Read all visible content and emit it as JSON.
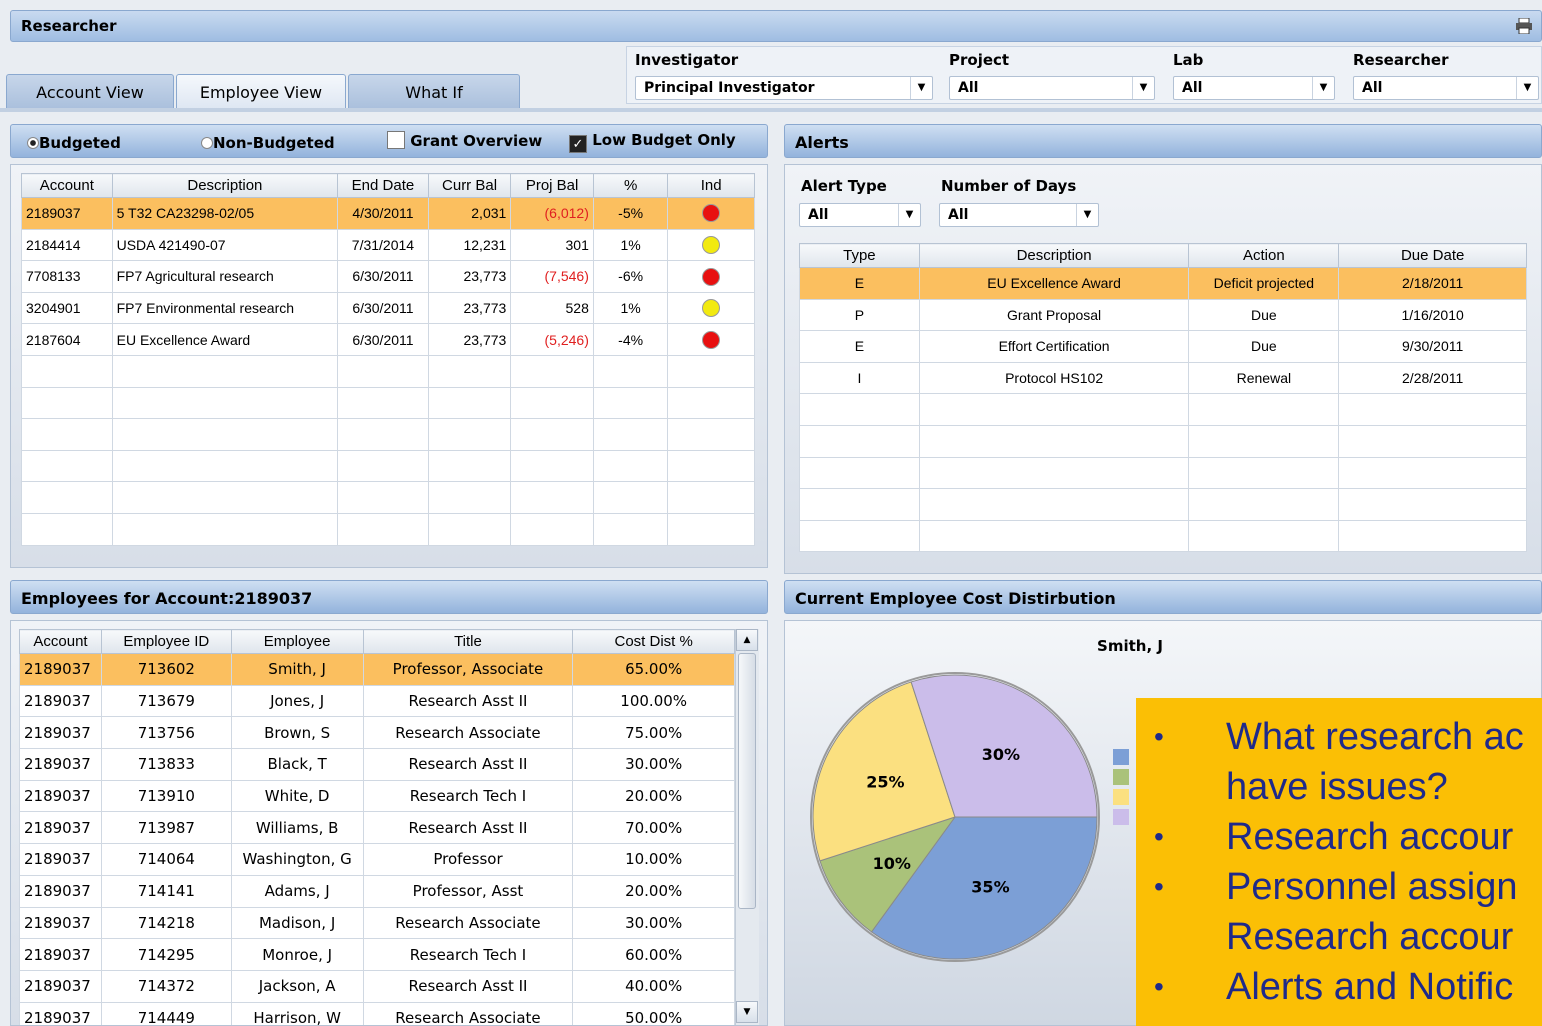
{
  "app": {
    "title": "Researcher"
  },
  "tabs": [
    {
      "label": "Account View"
    },
    {
      "label": "Employee View"
    },
    {
      "label": "What If"
    }
  ],
  "filters": {
    "investigator": {
      "label": "Investigator",
      "value": "Principal Investigator"
    },
    "project": {
      "label": "Project",
      "value": "All"
    },
    "lab": {
      "label": "Lab",
      "value": "All"
    },
    "researcher": {
      "label": "Researcher",
      "value": "All"
    }
  },
  "budget_options": {
    "budgeted": "Budgeted",
    "non_budgeted": "Non-Budgeted",
    "grant_overview": "Grant Overview",
    "low_budget_only": "Low Budget Only"
  },
  "accounts": {
    "columns": [
      "Account",
      "Description",
      "End Date",
      "Curr Bal",
      "Proj Bal",
      "%",
      "Ind"
    ],
    "rows": [
      {
        "account": "2189037",
        "description": "5 T32 CA23298-02/05",
        "end_date": "4/30/2011",
        "curr_bal": "2,031",
        "proj_bal": "(6,012)",
        "pct": "-5%",
        "ind": "#e81010"
      },
      {
        "account": "2184414",
        "description": "USDA 421490-07",
        "end_date": "7/31/2014",
        "curr_bal": "12,231",
        "proj_bal": "301",
        "pct": "1%",
        "ind": "#f2ea10"
      },
      {
        "account": "7708133",
        "description": "FP7 Agricultural research",
        "end_date": "6/30/2011",
        "curr_bal": "23,773",
        "proj_bal": "(7,546)",
        "pct": "-6%",
        "ind": "#e81010"
      },
      {
        "account": "3204901",
        "description": "FP7 Environmental research",
        "end_date": "6/30/2011",
        "curr_bal": "23,773",
        "proj_bal": "528",
        "pct": "1%",
        "ind": "#f2ea10"
      },
      {
        "account": "2187604",
        "description": "EU Excellence Award",
        "end_date": "6/30/2011",
        "curr_bal": "23,773",
        "proj_bal": "(5,246)",
        "pct": "-4%",
        "ind": "#e81010"
      }
    ]
  },
  "alerts": {
    "title": "Alerts",
    "alert_type": {
      "label": "Alert Type",
      "value": "All"
    },
    "number_of_days": {
      "label": "Number of Days",
      "value": "All"
    },
    "columns": [
      "Type",
      "Description",
      "Action",
      "Due Date"
    ],
    "rows": [
      {
        "type": "E",
        "description": "EU Excellence Award",
        "action": "Deficit projected",
        "due": "2/18/2011"
      },
      {
        "type": "P",
        "description": "Grant Proposal",
        "action": "Due",
        "due": "1/16/2010"
      },
      {
        "type": "E",
        "description": "Effort Certification",
        "action": "Due",
        "due": "9/30/2011"
      },
      {
        "type": "I",
        "description": "Protocol HS102",
        "action": "Renewal",
        "due": "2/28/2011"
      }
    ]
  },
  "employees": {
    "title": "Employees for Account:2189037",
    "columns": [
      "Account",
      "Employee ID",
      "Employee",
      "Title",
      "Cost Dist %"
    ],
    "rows": [
      {
        "account": "2189037",
        "id": "713602",
        "name": "Smith, J",
        "title": "Professor, Associate",
        "dist": "65.00%"
      },
      {
        "account": "2189037",
        "id": "713679",
        "name": "Jones, J",
        "title": "Research Asst II",
        "dist": "100.00%"
      },
      {
        "account": "2189037",
        "id": "713756",
        "name": "Brown, S",
        "title": "Research Associate",
        "dist": "75.00%"
      },
      {
        "account": "2189037",
        "id": "713833",
        "name": "Black, T",
        "title": "Research Asst II",
        "dist": "30.00%"
      },
      {
        "account": "2189037",
        "id": "713910",
        "name": "White, D",
        "title": "Research Tech I",
        "dist": "20.00%"
      },
      {
        "account": "2189037",
        "id": "713987",
        "name": "Williams, B",
        "title": "Research Asst II",
        "dist": "70.00%"
      },
      {
        "account": "2189037",
        "id": "714064",
        "name": "Washington, G",
        "title": "Professor",
        "dist": "10.00%"
      },
      {
        "account": "2189037",
        "id": "714141",
        "name": "Adams, J",
        "title": "Professor, Asst",
        "dist": "20.00%"
      },
      {
        "account": "2189037",
        "id": "714218",
        "name": "Madison, J",
        "title": "Research Associate",
        "dist": "30.00%"
      },
      {
        "account": "2189037",
        "id": "714295",
        "name": "Monroe, J",
        "title": "Research Tech I",
        "dist": "60.00%"
      },
      {
        "account": "2189037",
        "id": "714372",
        "name": "Jackson, A",
        "title": "Research Asst II",
        "dist": "40.00%"
      },
      {
        "account": "2189037",
        "id": "714449",
        "name": "Harrison, W",
        "title": "Research Associate",
        "dist": "50.00%"
      }
    ]
  },
  "cost_panel": {
    "title": "Current Employee Cost Distirbution"
  },
  "chart_data": {
    "type": "pie",
    "title": "Smith, J",
    "labels": [
      "",
      "",
      "",
      ""
    ],
    "values": [
      35,
      10,
      25,
      30
    ],
    "colors": [
      "#7c9fd6",
      "#aac27a",
      "#fbe080",
      "#cbbdea"
    ]
  },
  "callout": {
    "items": [
      "What research ac",
      "have issues?",
      "Research accour",
      "Personnel assign",
      "Research accour",
      "Alerts and Notific"
    ]
  }
}
